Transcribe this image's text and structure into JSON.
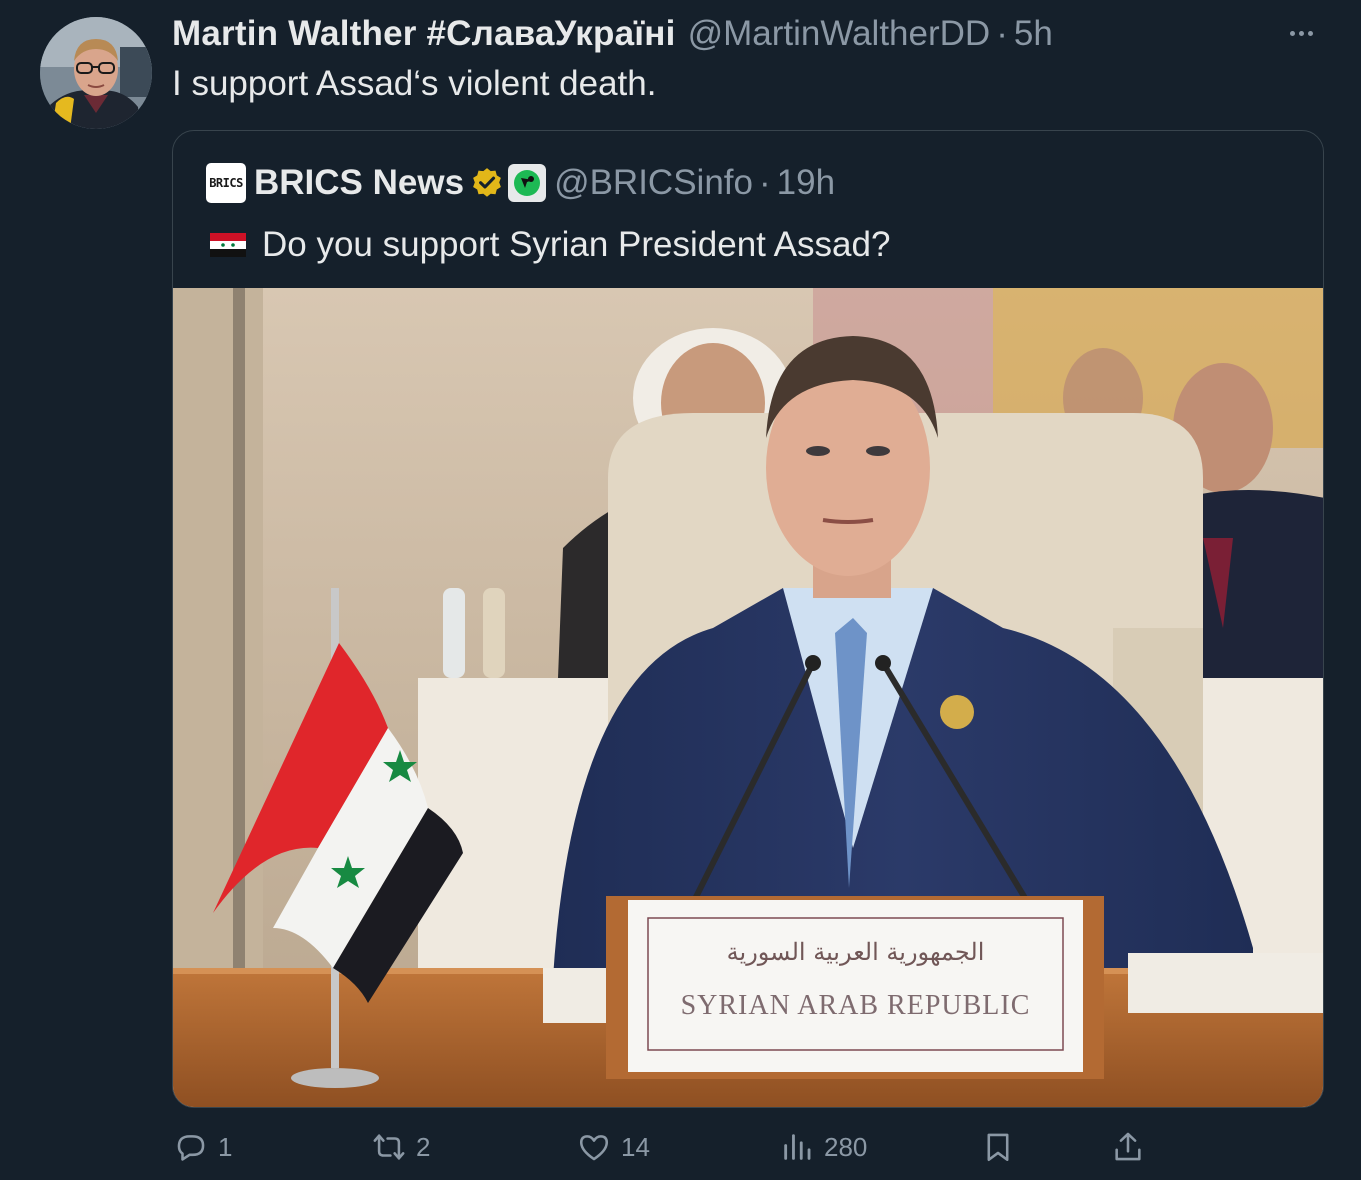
{
  "author": {
    "display_name": "Martin Walther #СлаваУкраїні",
    "handle": "@MartinWaltherDD",
    "separator": "·",
    "time": "5h"
  },
  "tweet": {
    "text": "I support Assad‘s violent death."
  },
  "quoted": {
    "logo_text": "BRICS",
    "display_name": "BRICS News",
    "handle": "@BRICSinfo",
    "separator": "·",
    "time": "19h",
    "text": "Do you support Syrian President Assad?",
    "flag_icon": "syria-flag-icon",
    "verified_color": "#e2b719",
    "photo": {
      "placard_arabic": "الجمهورية العربية السورية",
      "placard_english": "SYRIAN ARAB REPUBLIC"
    }
  },
  "actions": {
    "replies": "1",
    "reposts": "2",
    "likes": "14",
    "views": "280"
  },
  "colors": {
    "background": "#15202b",
    "text": "#e7e9ea",
    "secondary": "#8b98a5",
    "border": "#38444d"
  }
}
